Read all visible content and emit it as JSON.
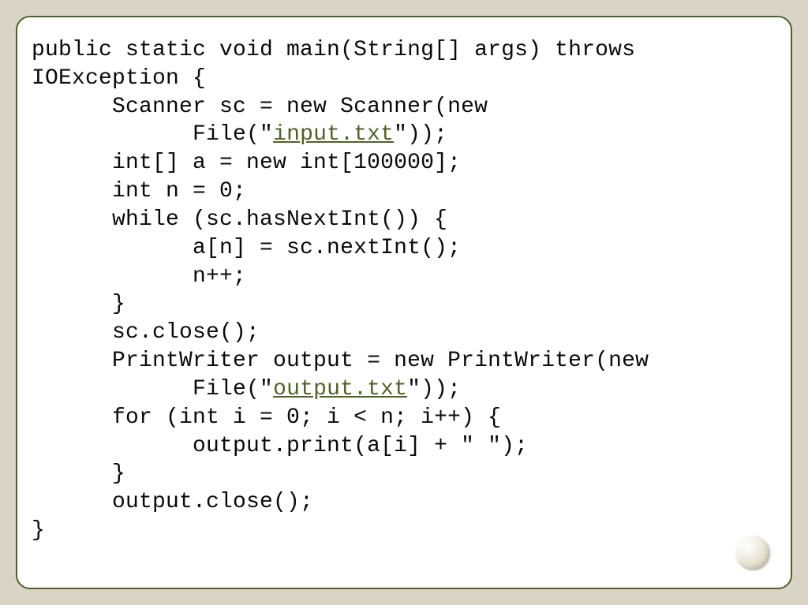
{
  "code": {
    "l1": "public static void main(String[] args) throws",
    "l2": "IOException {",
    "l3": "      Scanner sc = new Scanner(new",
    "l4a": "            File(\"",
    "l4link": "input.txt",
    "l4b": "\"));",
    "l5": "      int[] a = new int[100000];",
    "l6": "      int n = 0;",
    "l7": "      while (sc.hasNextInt()) {",
    "l8": "            a[n] = sc.nextInt();",
    "l9": "            n++;",
    "l10": "      }",
    "l11": "      sc.close();",
    "l12": "      PrintWriter output = new PrintWriter(new",
    "l13a": "            File(\"",
    "l13link": "output.txt",
    "l13b": "\"));",
    "l14": "      for (int i = 0; i < n; i++) {",
    "l15": "            output.print(a[i] + \" \");",
    "l16": "      }",
    "l17": "      output.close();",
    "l18": "}"
  }
}
